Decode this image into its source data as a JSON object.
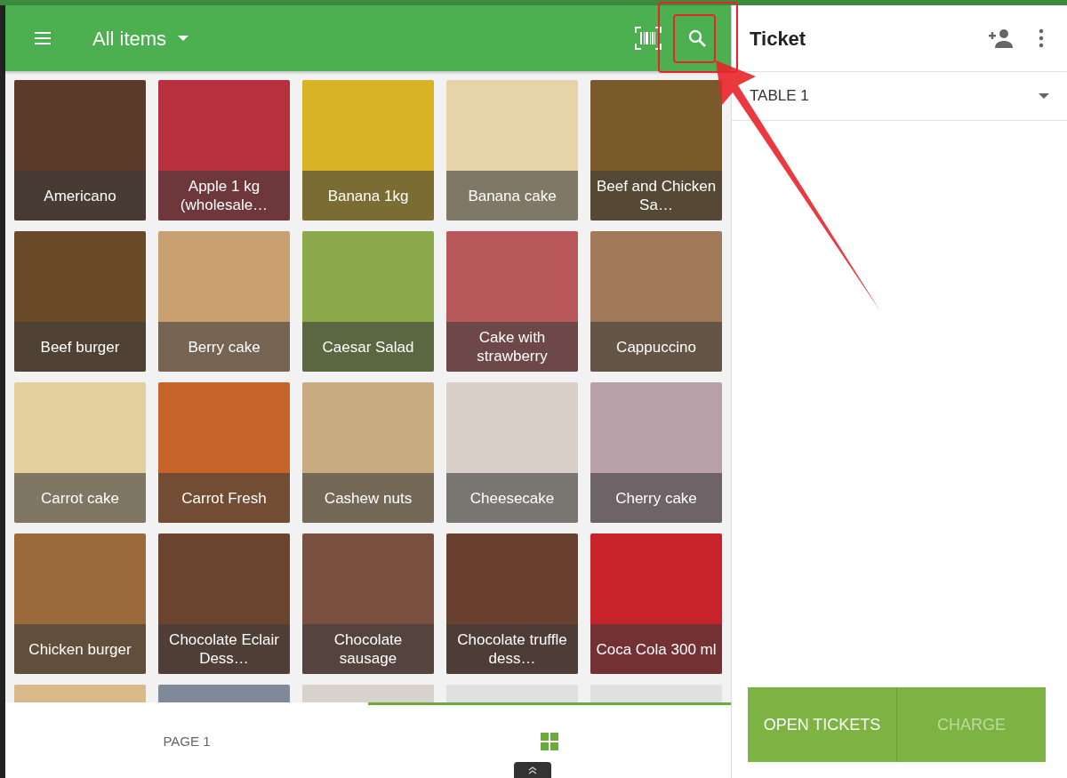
{
  "toolbar": {
    "title": "All items"
  },
  "items": [
    {
      "name": "Americano"
    },
    {
      "name": "Apple 1 kg (wholesale…"
    },
    {
      "name": "Banana 1kg"
    },
    {
      "name": "Banana cake"
    },
    {
      "name": "Beef and Chicken Sa…"
    },
    {
      "name": "Beef burger"
    },
    {
      "name": "Berry cake"
    },
    {
      "name": "Caesar Salad"
    },
    {
      "name": "Cake with strawberry"
    },
    {
      "name": "Cappuccino"
    },
    {
      "name": "Carrot cake"
    },
    {
      "name": "Carrot Fresh"
    },
    {
      "name": "Cashew nuts"
    },
    {
      "name": "Cheesecake"
    },
    {
      "name": "Cherry cake"
    },
    {
      "name": "Chicken burger"
    },
    {
      "name": "Chocolate Eclair Dess…"
    },
    {
      "name": "Chocolate sausage"
    },
    {
      "name": "Chocolate truffle dess…"
    },
    {
      "name": "Coca Cola 300 ml"
    }
  ],
  "page_tabs": [
    {
      "kind": "text",
      "label": "PAGE 1",
      "selected": false
    },
    {
      "kind": "grid",
      "selected": true
    }
  ],
  "ticket": {
    "title": "Ticket",
    "table": "TABLE 1"
  },
  "buttons": [
    {
      "label": "OPEN TICKETS",
      "disabled": false
    },
    {
      "label": "CHARGE",
      "disabled": true
    }
  ]
}
